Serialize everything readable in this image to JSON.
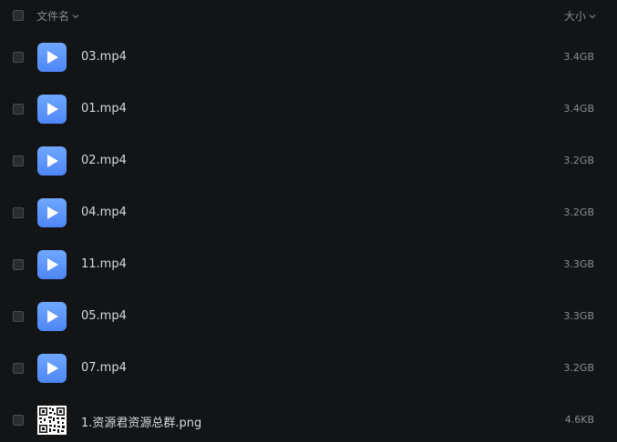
{
  "header": {
    "name_label": "文件名",
    "size_label": "大小"
  },
  "files": [
    {
      "name": "03.mp4",
      "size": "3.4GB",
      "icon": "video-play-icon"
    },
    {
      "name": "01.mp4",
      "size": "3.4GB",
      "icon": "video-play-icon"
    },
    {
      "name": "02.mp4",
      "size": "3.2GB",
      "icon": "video-play-icon"
    },
    {
      "name": "04.mp4",
      "size": "3.2GB",
      "icon": "video-play-icon"
    },
    {
      "name": "11.mp4",
      "size": "3.3GB",
      "icon": "video-play-icon"
    },
    {
      "name": "05.mp4",
      "size": "3.3GB",
      "icon": "video-play-icon"
    },
    {
      "name": "07.mp4",
      "size": "3.2GB",
      "icon": "video-play-icon"
    },
    {
      "name": "1.资源君资源总群.png",
      "size": "4.6KB",
      "icon": "qr-code-thumbnail-icon"
    }
  ],
  "colors": {
    "background": "#131416",
    "video_icon": "#5b93fa",
    "text_primary": "#d8dadd",
    "text_secondary": "#8a8c90"
  }
}
